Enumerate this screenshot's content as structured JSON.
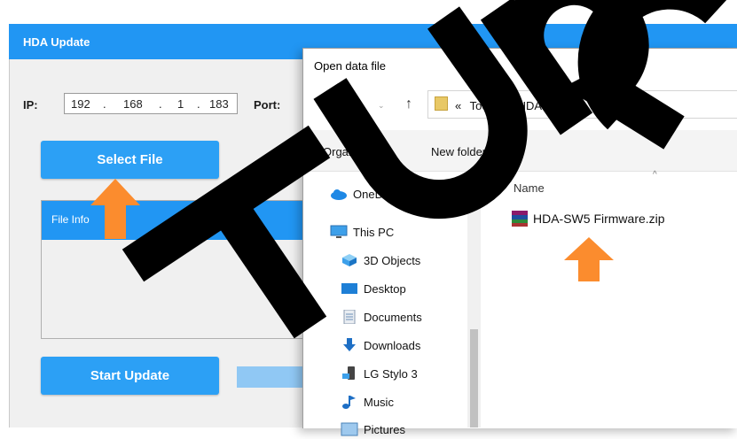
{
  "hda_window": {
    "title": "HDA Update",
    "ip_label": "IP:",
    "ip_octets": [
      "192",
      ".",
      "168",
      ".",
      "1",
      ".",
      "183"
    ],
    "port_label": "Port:",
    "select_file_label": "Select File",
    "file_info_label": "File Info",
    "start_update_label": "Start Update",
    "accent_color": "#2196f3"
  },
  "dialog": {
    "title": "Open data file",
    "breadcrumb": [
      "«",
      "Tools",
      "›",
      "HDA-SW5",
      "›"
    ],
    "toolbar": {
      "organize_label": "Organize ▾",
      "new_folder_label": "New folder"
    },
    "nav_items": [
      {
        "label": "OneDrive",
        "icon": "cloud-icon"
      },
      {
        "label": "This PC",
        "icon": "computer-icon"
      },
      {
        "label": "3D Objects",
        "icon": "cube-icon"
      },
      {
        "label": "Desktop",
        "icon": "desktop-icon"
      },
      {
        "label": "Documents",
        "icon": "document-icon"
      },
      {
        "label": "Downloads",
        "icon": "download-icon"
      },
      {
        "label": "LG Stylo 3",
        "icon": "phone-icon"
      },
      {
        "label": "Music",
        "icon": "music-icon"
      },
      {
        "label": "Pictures",
        "icon": "picture-icon"
      }
    ],
    "column_header": "Name",
    "file": {
      "name": "HDA-SW5 Firmware.zip",
      "icon": "zip-archive-icon"
    }
  },
  "annotation_color": "#fb8c2e",
  "watermark": "TURC"
}
